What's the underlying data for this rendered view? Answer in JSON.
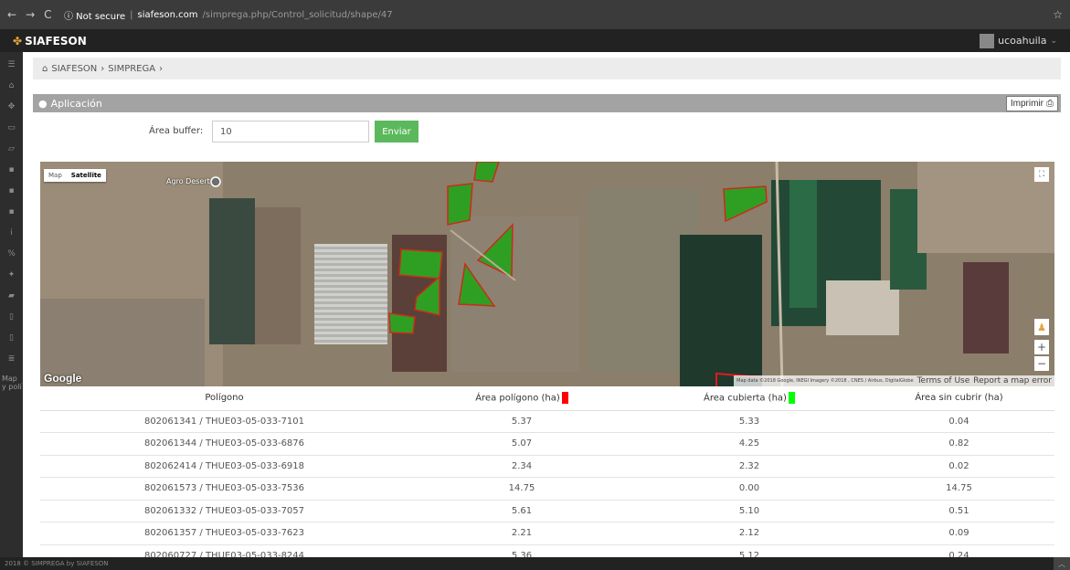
{
  "browser": {
    "back": "←",
    "forward": "→",
    "reload": "C",
    "security": "ⓘ Not secure",
    "domain": "siafeson.com",
    "path": "/simprega.php/Control_solicitud/shape/47",
    "star": "☆"
  },
  "app": {
    "brand": "SIAFESON",
    "brand_icon": "leaf-icon",
    "user": "ucoahuila"
  },
  "sidebar": {
    "items": [
      {
        "icon": "menu-icon",
        "glyph": "☰"
      },
      {
        "icon": "home-icon",
        "glyph": "⌂"
      },
      {
        "icon": "gear-icon",
        "glyph": "✥"
      },
      {
        "icon": "folder-icon",
        "glyph": "▭"
      },
      {
        "icon": "folder-open-icon",
        "glyph": "▱"
      },
      {
        "icon": "file-icon",
        "glyph": "▪"
      },
      {
        "icon": "file-icon",
        "glyph": "▪"
      },
      {
        "icon": "file-icon",
        "glyph": "▪"
      },
      {
        "icon": "info-icon",
        "glyph": "i"
      },
      {
        "icon": "percent-icon",
        "glyph": "%"
      },
      {
        "icon": "gear-icon",
        "glyph": "✦"
      },
      {
        "icon": "car-icon",
        "glyph": "▰"
      },
      {
        "icon": "document-icon",
        "glyph": "▯"
      },
      {
        "icon": "document-icon",
        "glyph": "▯"
      },
      {
        "icon": "list-icon",
        "glyph": "≣"
      }
    ],
    "footer_text": "Map y polí"
  },
  "breadcrumb": {
    "home": "SIAFESON",
    "sep1": "›",
    "section": "SIMPREGA",
    "sep2": "›"
  },
  "panel": {
    "title": "Aplicación",
    "print_label": "Imprimir"
  },
  "buffer": {
    "label": "Área buffer:",
    "value": "10",
    "submit": "Enviar"
  },
  "map": {
    "type_map": "Map",
    "type_satellite": "Satellite",
    "place": "Agro Desert",
    "logo": "Google",
    "attribution": "Map data ©2018 Google, INEGI Imagery ©2018 , CNES / Airbus, DigitalGlobe",
    "terms": "Terms of Use",
    "report": "Report a map error",
    "colors": {
      "ground": "#8a7d6a",
      "field_green": "#2e9a2a",
      "polygon_border": "#d7261e"
    }
  },
  "table": {
    "headers": {
      "poligono": "Polígono",
      "area_poligono": "Área polígono (ha)",
      "area_cubierta": "Área cubierta (ha)",
      "area_sin_cubrir": "Área sin cubrir (ha)"
    },
    "legend_colors": {
      "poligono": "#ff0000",
      "cubierta": "#00ff00"
    },
    "rows": [
      {
        "poligono": "802061341 / THUE03-05-033-7101",
        "area": "5.37",
        "cubierta": "5.33",
        "sin_cubrir": "0.04"
      },
      {
        "poligono": "802061344 / THUE03-05-033-6876",
        "area": "5.07",
        "cubierta": "4.25",
        "sin_cubrir": "0.82"
      },
      {
        "poligono": "802062414 / THUE03-05-033-6918",
        "area": "2.34",
        "cubierta": "2.32",
        "sin_cubrir": "0.02"
      },
      {
        "poligono": "802061573 / THUE03-05-033-7536",
        "area": "14.75",
        "cubierta": "0.00",
        "sin_cubrir": "14.75"
      },
      {
        "poligono": "802061332 / THUE03-05-033-7057",
        "area": "5.61",
        "cubierta": "5.10",
        "sin_cubrir": "0.51"
      },
      {
        "poligono": "802061357 / THUE03-05-033-7623",
        "area": "2.21",
        "cubierta": "2.12",
        "sin_cubrir": "0.09"
      },
      {
        "poligono": "802060727 / THUE03-05-033-8244",
        "area": "5.36",
        "cubierta": "5.12",
        "sin_cubrir": "0.24"
      }
    ]
  },
  "footer": {
    "text": "2018 © SIMPREGA by SIAFESON",
    "up": "︿"
  }
}
